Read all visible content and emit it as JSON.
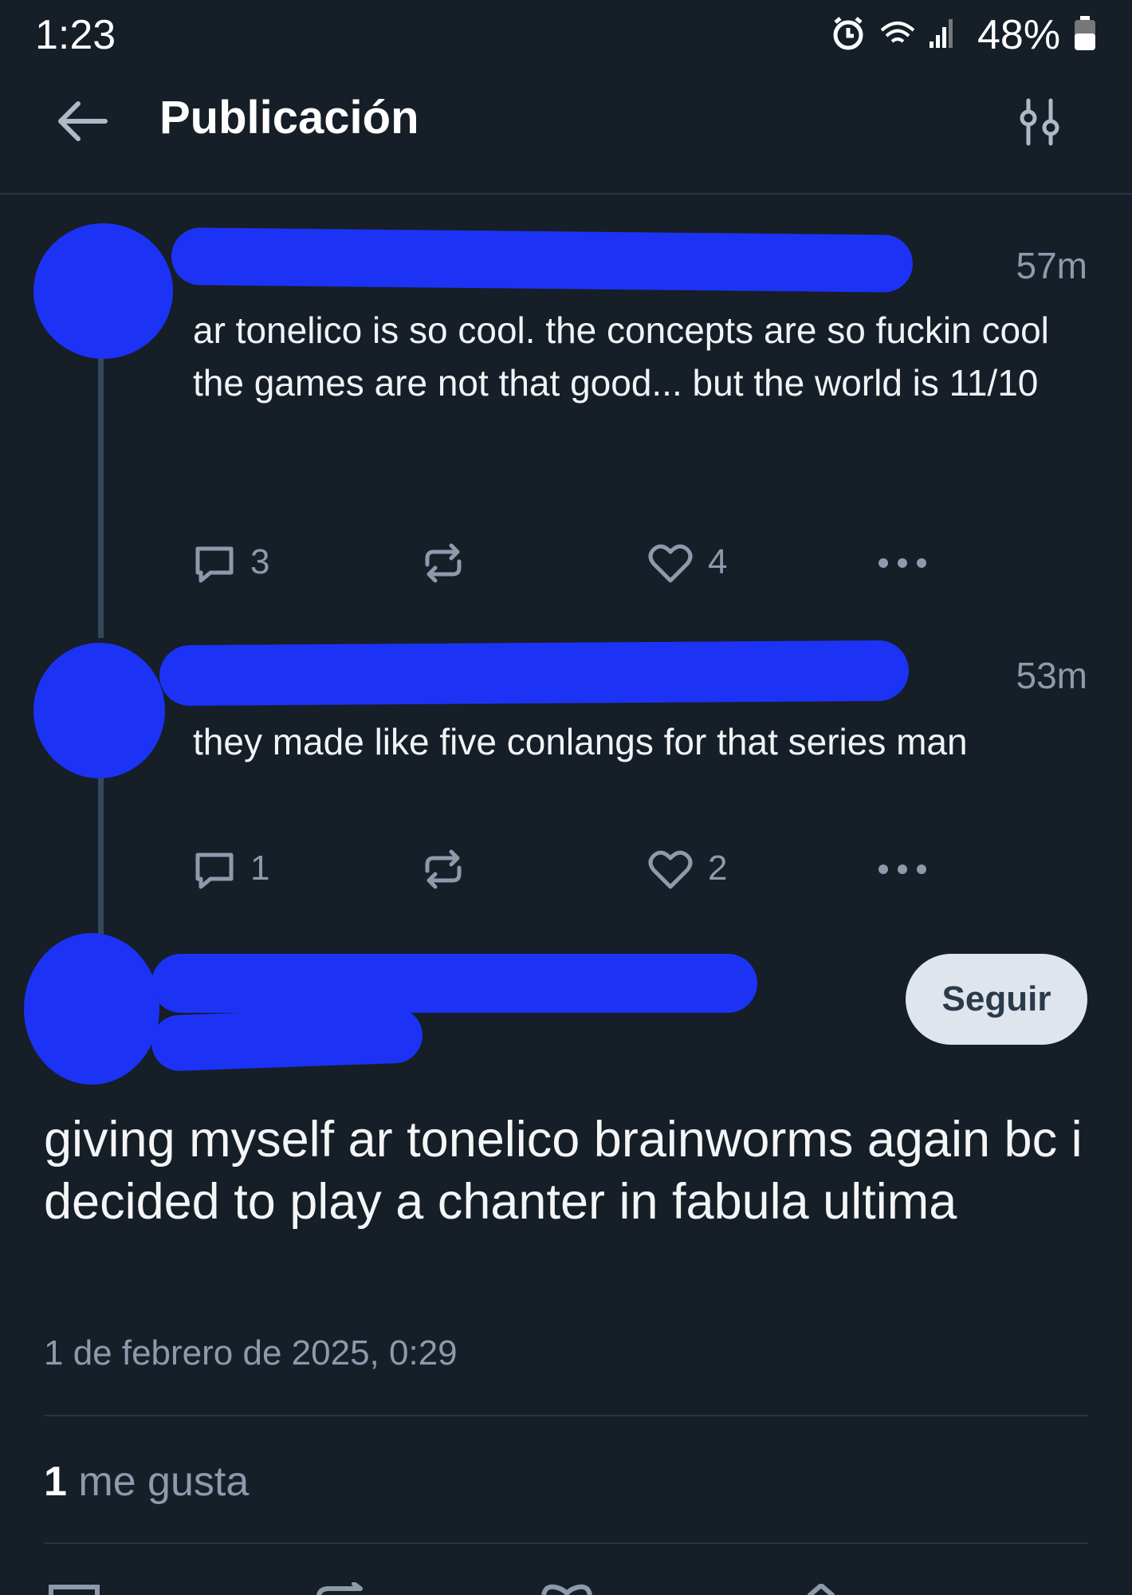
{
  "status_bar": {
    "time": "1:23",
    "battery": "48%"
  },
  "header": {
    "title": "Publicación"
  },
  "replies": [
    {
      "time": "57m",
      "text_line1": "ar tonelico is so cool. the concepts are so fuckin cool",
      "text_line2": "the games are not that good... but the world is 11/10",
      "comments": "3",
      "likes": "4"
    },
    {
      "time": "53m",
      "text_line1": "they made like five conlangs for that series man",
      "comments": "1",
      "likes": "2"
    }
  ],
  "main_post": {
    "follow_label": "Seguir",
    "text": "giving myself ar tonelico brainworms again bc i decided to play a chanter in fabula ultima",
    "date": "1 de febrero de 2025, 0:29",
    "likes_count": "1",
    "likes_label": "me gusta"
  },
  "colors": {
    "background": "#161e27",
    "redaction": "#1c33f5",
    "muted": "#8d9aab"
  }
}
